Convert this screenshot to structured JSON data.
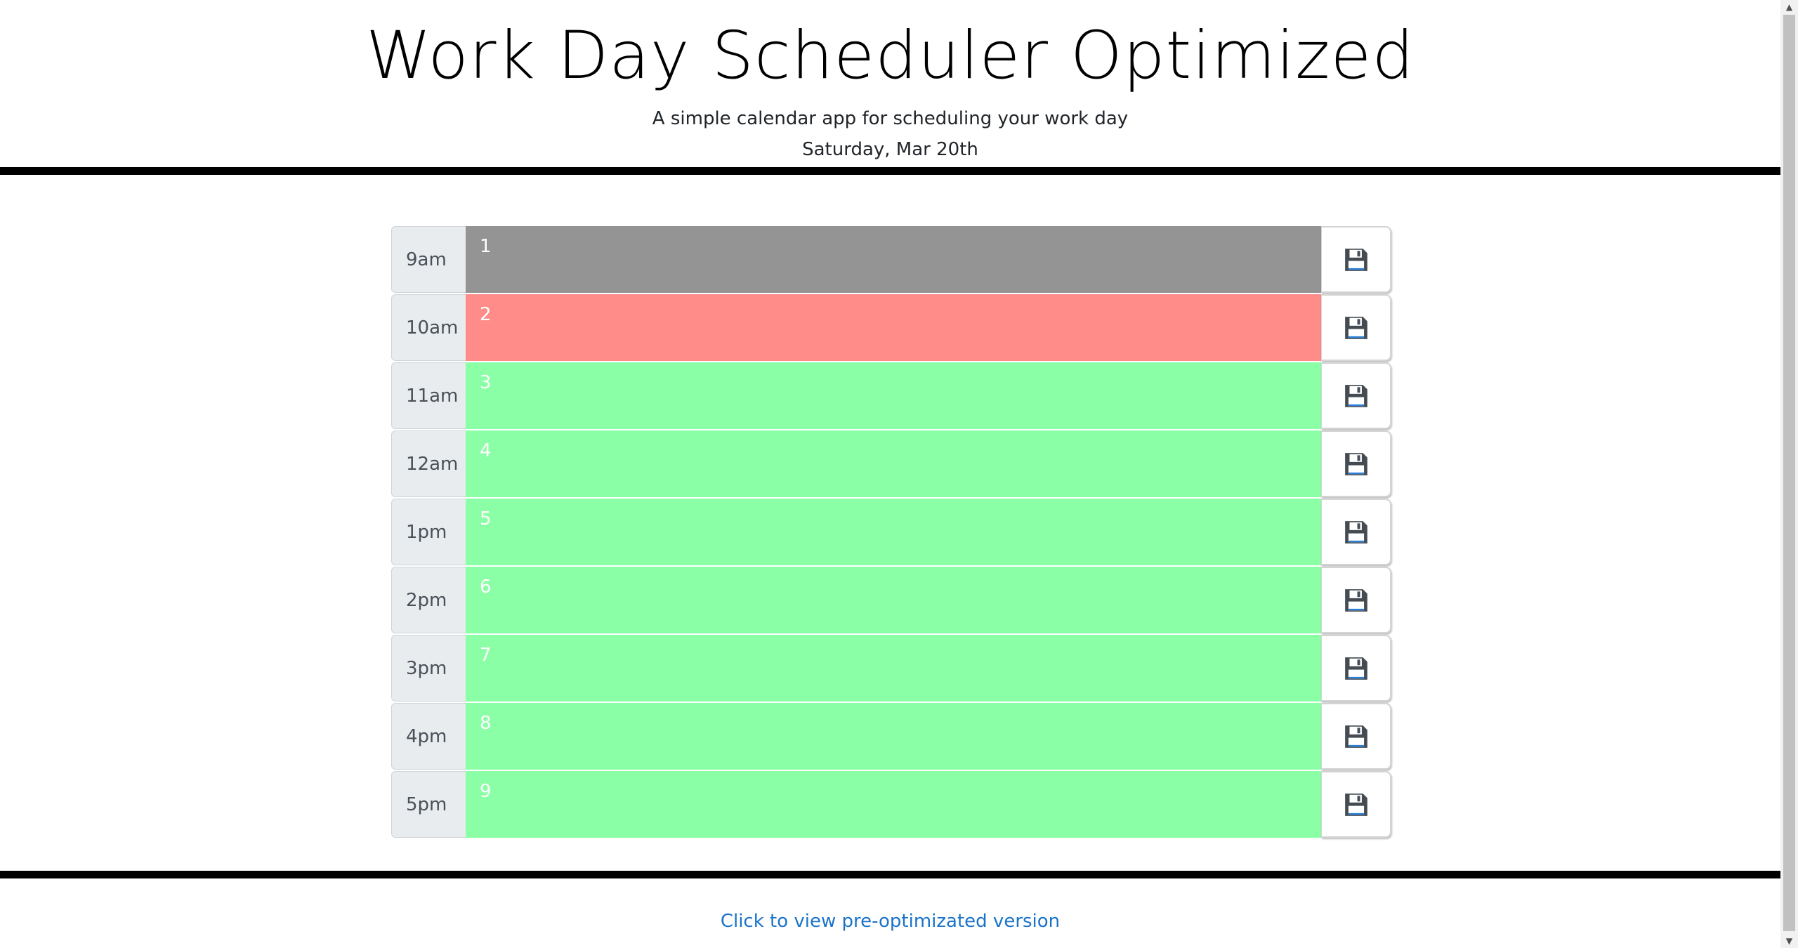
{
  "header": {
    "title": "Work Day Scheduler Optimized",
    "subtitle": "A simple calendar app for scheduling your work day",
    "date": "Saturday, Mar 20th"
  },
  "colors": {
    "past": "#949494",
    "present": "#ff8c88",
    "future": "#8affa5",
    "link": "#1a73c8"
  },
  "rows": [
    {
      "hour": "9am",
      "text": "1",
      "state": "past"
    },
    {
      "hour": "10am",
      "text": "2",
      "state": "present"
    },
    {
      "hour": "11am",
      "text": "3",
      "state": "future"
    },
    {
      "hour": "12am",
      "text": "4",
      "state": "future"
    },
    {
      "hour": "1pm",
      "text": "5",
      "state": "future"
    },
    {
      "hour": "2pm",
      "text": "6",
      "state": "future"
    },
    {
      "hour": "3pm",
      "text": "7",
      "state": "future"
    },
    {
      "hour": "4pm",
      "text": "8",
      "state": "future"
    },
    {
      "hour": "5pm",
      "text": "9",
      "state": "future"
    }
  ],
  "save_icon": "floppy-disk-icon",
  "footer": {
    "link_text": "Click to view pre-optimizated version"
  }
}
